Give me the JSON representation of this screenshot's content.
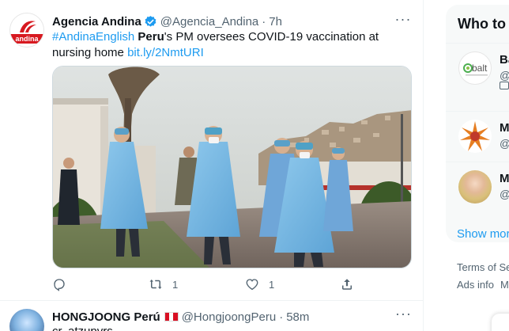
{
  "tweet1": {
    "author_name": "Agencia Andina",
    "handle": "@Agencia_Andina",
    "separator": "·",
    "time": "7h",
    "avatar_text": "andina",
    "text_hashtag": "#AndinaEnglish",
    "text_bold": "Peru",
    "text_rest": "'s PM oversees COVID-19 vaccination at nursing home",
    "text_link": "bit.ly/2NmtURI",
    "more_icon": "more-horizontal-icon",
    "actions": {
      "reply_count": "",
      "retweet_count": "1",
      "like_count": "1"
    }
  },
  "tweet2": {
    "author_name": "HONGJOONG Perú",
    "handle": "@HongjoongPeru",
    "separator": "·",
    "time": "58m",
    "text": "cr. atzupvrs"
  },
  "sidebar": {
    "title": "Who to follow",
    "suggestions": [
      {
        "name": "Balt",
        "handle": "@",
        "avatar_text": "balt",
        "promoted": true
      },
      {
        "name": "M",
        "handle": "@"
      },
      {
        "name": "M",
        "handle": "@"
      }
    ],
    "show_more": "Show more",
    "footer_line1": "Terms of Se",
    "footer_ads": "Ads info",
    "footer_more": "M"
  },
  "colors": {
    "accent": "#1d9bf0",
    "text_secondary": "#536471",
    "andina_red": "#d71920",
    "peru_red": "#d91023"
  }
}
